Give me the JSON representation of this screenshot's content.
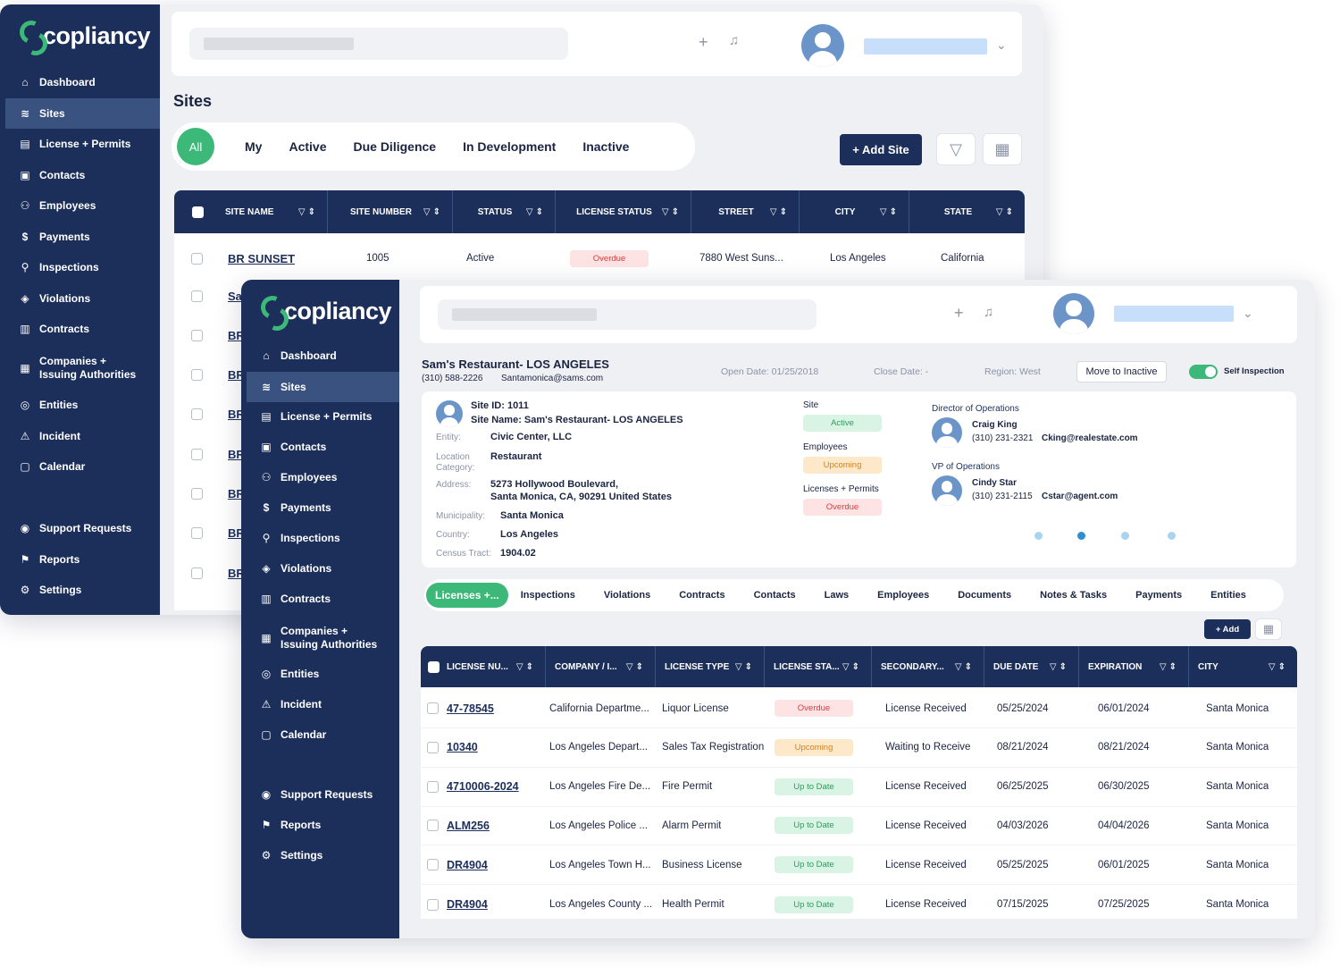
{
  "brand": "copliancy",
  "nav": [
    {
      "label": "Dashboard",
      "icon": "home-icon",
      "glyph": "⌂"
    },
    {
      "label": "Sites",
      "icon": "sites-icon",
      "glyph": "≋"
    },
    {
      "label": "License + Permits",
      "icon": "license-icon",
      "glyph": "▤"
    },
    {
      "label": "Contacts",
      "icon": "contacts-icon",
      "glyph": "▣"
    },
    {
      "label": "Employees",
      "icon": "employees-icon",
      "glyph": "⚇"
    },
    {
      "label": "Payments",
      "icon": "payments-icon",
      "glyph": "$"
    },
    {
      "label": "Inspections",
      "icon": "search-icon",
      "glyph": "⚲"
    },
    {
      "label": "Violations",
      "icon": "shield-icon",
      "glyph": "◈"
    },
    {
      "label": "Contracts",
      "icon": "contracts-icon",
      "glyph": "▥"
    },
    {
      "label": "Companies +",
      "label2": "Issuing Authorities",
      "icon": "building-icon",
      "glyph": "▦"
    },
    {
      "label": "Entities",
      "icon": "entities-icon",
      "glyph": "◎"
    },
    {
      "label": "Incident",
      "icon": "incident-icon",
      "glyph": "⚠"
    },
    {
      "label": "Calendar",
      "icon": "calendar-icon",
      "glyph": "▢"
    },
    {
      "label": "Support Requests",
      "icon": "support-icon",
      "glyph": "◉"
    },
    {
      "label": "Reports",
      "icon": "flag-icon",
      "glyph": "⚑"
    },
    {
      "label": "Settings",
      "icon": "gear-icon",
      "glyph": "⚙"
    }
  ],
  "back": {
    "title": "Sites",
    "tabs": [
      "All",
      "My",
      "Active",
      "Due Diligence",
      "In Development",
      "Inactive"
    ],
    "add_site": "+ Add Site",
    "columns": [
      "SITE NAME",
      "SITE NUMBER",
      "STATUS",
      "LICENSE STATUS",
      "STREET",
      "CITY",
      "STATE"
    ],
    "row": {
      "name": "BR SUNSET",
      "number": "1005",
      "status": "Active",
      "license_status": "Overdue",
      "street": "7880 West Suns...",
      "city": "Los Angeles",
      "state": "California"
    },
    "partial_rows": [
      "Sa",
      "BR",
      "BR",
      "BR",
      "BR",
      "BR",
      "BR",
      "BR",
      "BR"
    ]
  },
  "front": {
    "site_title": "Sam's Restaurant- LOS ANGELES",
    "phone": "(310) 588-2226",
    "email": "Santamonica@sams.com",
    "open_date": "Open Date: 01/25/2018",
    "close_date": "Close Date: -",
    "region": "Region: West",
    "move_inactive": "Move to Inactive",
    "self_inspection": "Self Inspection",
    "site_id": "Site ID: 1011",
    "site_name": "Site Name: Sam's Restaurant- LOS ANGELES",
    "details": [
      {
        "label": "Entity:",
        "value": "Civic Center, LLC"
      },
      {
        "label": "Location",
        "label2": "Category:",
        "value": "Restaurant"
      },
      {
        "label": "Address:",
        "value": "5273 Hollywood Boulevard,",
        "value2": "Santa Monica, CA, 90291 United States"
      },
      {
        "label": "Municipality:",
        "value": "Santa Monica"
      },
      {
        "label": "Country:",
        "value": "Los Angeles"
      },
      {
        "label": "Census Tract:",
        "value": "1904.02"
      }
    ],
    "status_blocks": [
      {
        "label": "Site",
        "badge": "Active",
        "kind": "active"
      },
      {
        "label": "Employees",
        "badge": "Upcoming",
        "kind": "upcoming"
      },
      {
        "label": "Licenses + Permits",
        "badge": "Overdue",
        "kind": "overdue"
      }
    ],
    "contacts": [
      {
        "role": "Director of Operations",
        "name": "Craig King",
        "phone": "(310) 231-2321",
        "email": "Cking@realestate.com"
      },
      {
        "role": "VP of Operations",
        "name": "Cindy Star",
        "phone": "(310) 231-2115",
        "email": "Cstar@agent.com"
      }
    ],
    "subtabs": [
      "Licenses +...",
      "Inspections",
      "Violations",
      "Contracts",
      "Contacts",
      "Laws",
      "Employees",
      "Documents",
      "Notes & Tasks",
      "Payments",
      "Entities"
    ],
    "add": "+ Add",
    "columns": [
      "LICENSE NU...",
      "COMPANY / I...",
      "LICENSE TYPE",
      "LICENSE STA...",
      "SECONDARY...",
      "DUE DATE",
      "EXPIRATION",
      "CITY"
    ],
    "rows": [
      {
        "num": "47-78545",
        "company": "California Departme...",
        "type": "Liquor License",
        "status": "Overdue",
        "kind": "overdue",
        "secondary": "License Received",
        "due": "05/25/2024",
        "exp": "06/01/2024",
        "city": "Santa Monica"
      },
      {
        "num": "10340",
        "company": "Los Angeles Depart...",
        "type": "Sales Tax Registration",
        "status": "Upcoming",
        "kind": "upcoming",
        "secondary": "Waiting to Receive",
        "due": "08/21/2024",
        "exp": "08/21/2024",
        "city": "Santa Monica"
      },
      {
        "num": "4710006-2024",
        "company": "Los Angeles Fire De...",
        "type": "Fire Permit",
        "status": "Up to Date",
        "kind": "uptodate",
        "secondary": "License Received",
        "due": "06/25/2025",
        "exp": "06/30/2025",
        "city": "Santa Monica"
      },
      {
        "num": "ALM256",
        "company": "Los Angeles Police ...",
        "type": "Alarm Permit",
        "status": "Up to Date",
        "kind": "uptodate",
        "secondary": "License Received",
        "due": "04/03/2026",
        "exp": "04/04/2026",
        "city": "Santa Monica"
      },
      {
        "num": "DR4904",
        "company": "Los Angeles Town H...",
        "type": "Business License",
        "status": "Up to Date",
        "kind": "uptodate",
        "secondary": "License Received",
        "due": "05/25/2025",
        "exp": "06/01/2025",
        "city": "Santa Monica"
      },
      {
        "num": "DR4904",
        "company": "Los Angeles County ...",
        "type": "Health Permit",
        "status": "Up to Date",
        "kind": "uptodate",
        "secondary": "License Received",
        "due": "07/15/2025",
        "exp": "07/25/2025",
        "city": "Santa Monica"
      }
    ]
  }
}
